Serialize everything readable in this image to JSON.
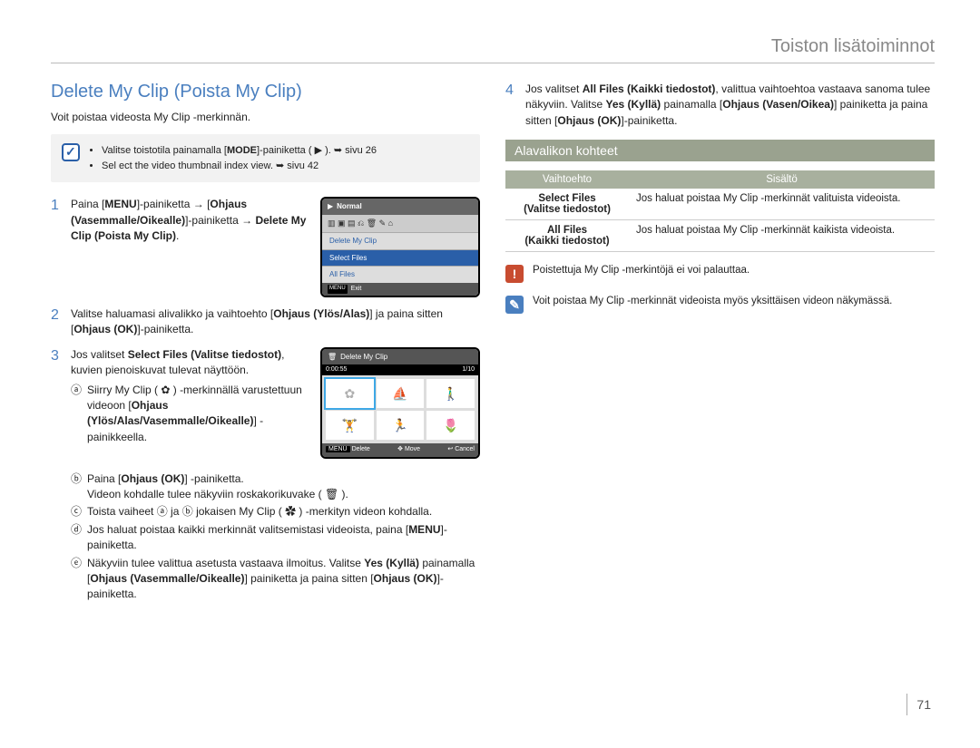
{
  "header": "Toiston lisätoiminnot",
  "page_number": "71",
  "title": "Delete My Clip (Poista My Clip)",
  "intro": "Voit poistaa videosta My Clip -merkinnän.",
  "tip": {
    "line1_pre": "Valitse toistotila painamalla [",
    "line1_bold": "MODE",
    "line1_post": "]-painiketta ( ▶ ).  ➥ sivu 26",
    "line2": "Sel ect the video thumbnail index view.  ➥ sivu 42"
  },
  "steps": [
    {
      "n": "1",
      "parts": [
        "Paina [",
        "MENU",
        "]-painiketta → [",
        "Ohjaus (Vasemmalle/Oikealle)",
        "]-painiketta → ",
        "Delete My Clip (Poista My Clip)",
        "."
      ]
    },
    {
      "n": "2",
      "parts": [
        "Valitse haluamasi alivalikko ja vaihtoehto [",
        "Ohjaus (Ylös/Alas)",
        "] ja paina sitten [",
        "Ohjaus (OK)",
        "]-painiketta."
      ]
    },
    {
      "n": "3",
      "parts": [
        "Jos valitset ",
        "Select Files (Valitse tiedostot)",
        ", kuvien pienoiskuvat tulevat näyttöön."
      ]
    },
    {
      "n": "4",
      "parts": [
        "Jos valitset ",
        "All Files (Kaikki tiedostot)",
        ", valittua vaihtoehtoa vastaava sanoma tulee näkyviin. Valitse ",
        "Yes (Kyllä)",
        " painamalla [",
        "Ohjaus (Vasen/Oikea)",
        "] painiketta ja paina sitten [",
        "Ohjaus (OK)",
        "]-painiketta."
      ]
    }
  ],
  "sub3": {
    "a": {
      "parts": [
        "Siirry My Clip ( ✿ ) -merkinnällä varustettuun videoon [",
        "Ohjaus (Ylös/Alas/Vasemmalle/Oikealle)",
        "] -painikkeella."
      ]
    },
    "b": {
      "parts": [
        "Paina [",
        "Ohjaus (OK)",
        "] -painiketta."
      ],
      "tail": "Videon kohdalle tulee näkyviin roskakorikuvake ( 🗑 )."
    },
    "c": "Toista vaiheet ⓐ ja ⓑ jokaisen My Clip ( ✿ ) -merkityn videon kohdalla.",
    "d": {
      "parts": [
        "Jos haluat poistaa kaikki merkinnät valitsemistasi videoista, paina [",
        "MENU",
        "]-painiketta."
      ]
    },
    "e": {
      "parts": [
        "Näkyviin tulee valittua asetusta vastaava ilmoitus. Valitse ",
        "Yes (Kyllä)",
        " painamalla [",
        "Ohjaus (Vasemmalle/Oikealle)",
        "] painiketta ja paina sitten [",
        "Ohjaus (OK)",
        "]-painiketta."
      ]
    }
  },
  "screen1": {
    "top_mode": "▶",
    "top_label": "Normal",
    "menu_items": [
      "Delete My Clip",
      "Select Files",
      "All Files"
    ],
    "selected_index": 1,
    "exit_key": "MENU",
    "exit_label": "Exit"
  },
  "screen2": {
    "trash": "🗑",
    "title": "Delete My Clip",
    "time": "0:00:55",
    "count": "1/10",
    "actions": {
      "menu_key": "MENU",
      "delete": "Delete",
      "move": "Move",
      "cancel": "Cancel"
    }
  },
  "submenu_header": "Alavalikon kohteet",
  "table": {
    "head": {
      "opt": "Vaihtoehto",
      "desc": "Sisältö"
    },
    "rows": [
      {
        "opt_l1": "Select Files",
        "opt_l2": "(Valitse tiedostot)",
        "desc": "Jos haluat poistaa My Clip -merkinnät valituista videoista."
      },
      {
        "opt_l1": "All Files",
        "opt_l2": "(Kaikki tiedostot)",
        "desc": "Jos haluat poistaa My Clip -merkinnät kaikista videoista."
      }
    ]
  },
  "note_warn": "Poistettuja My Clip -merkintöjä ei voi palauttaa.",
  "note_info": "Voit poistaa My Clip -merkinnät videoista myös yksittäisen videon näkymässä."
}
